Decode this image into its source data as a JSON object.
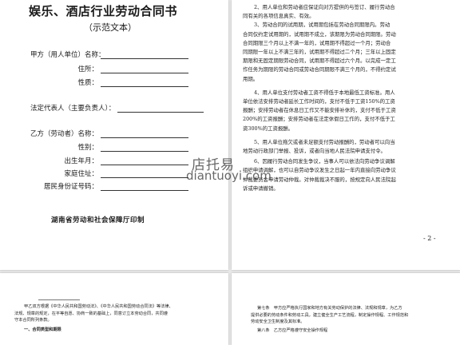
{
  "page1": {
    "title": "娱乐、酒店行业劳动合同书",
    "subtitle": "（示范文本）",
    "fields": [
      {
        "label": "甲方（用人单位）名称："
      },
      {
        "label": "住所："
      },
      {
        "label": "性质："
      },
      {
        "label": "法定代表人（主要负责人）："
      },
      {
        "label": "乙方（劳动者）名称："
      },
      {
        "label": "性别："
      },
      {
        "label": "出生年月："
      },
      {
        "label": "家庭住址："
      },
      {
        "label": "居民身份证号码："
      }
    ],
    "issuer": "湖南省劳动和社会保障厅印制"
  },
  "page2": {
    "lines": [
      "2、用人单位和劳动者应保证向对方提供的与签订、履行劳动合",
      "同有关的各项信息真实、有效。",
      "3、劳动合同的试用期，试用期包括在劳动合同期限内。劳动",
      "合同仅约定试用期的，试用期不成立，该期限为劳动合同期限。劳动",
      "合同期限三个月以上不满一年的，试用期不得超过一个月；劳动合",
      "同期限一年以上不满三年的，试用期不得超过二个月；三年以上固定",
      "期限和无固定期限劳动合同，试用期不得超过六个月。以完成一定工",
      "作任务为期限的劳动合同或劳动合同期限不满三个月的，不得约定试",
      "用期。",
      "4、用人单位支付劳动者工资不得低于本地最低工资标准。用人",
      "单位依法安排劳动者延长工作时间的，支付不低于工资150%的工资",
      "报酬；安排劳动者在休息日工作又不能安排补休的，支付不低于工资",
      "200%的工资报酬；安排劳动者在法定休假日工作的，支付不低于工",
      "资300%的工资报酬。",
      "5、用人单位拖欠或者未足额支付劳动报酬的，劳动者可以向当",
      "地劳动行政部门举报、投诉，或者向当地人民法院申请支付令。",
      "6、因履行劳动合同发生争议，当事人可以依法向劳动争议调解",
      "组织申请调解，也可以自劳动争议发生之日起一年内直接向劳动争议",
      "仲裁委员会申请劳动仲裁。对仲裁裁决不服的，按规定向人民法院起",
      "诉或申请撤销。"
    ],
    "page_number": "- 2 -"
  },
  "page3": {
    "lines": [
      "甲乙双方根据《中华人民共和国劳动法》、《中华人民共和国劳动合同法》等法律、",
      "法规、规章的规定，在平等自愿、协商一致的基础上，同意订立本劳动合同，共同遵",
      "守本合同所列条款。",
      "一、合同类型和期限"
    ]
  },
  "page4": {
    "lines": [
      "第七条　甲方应严格执行国家和地方有关劳动保护的法律、法规和规章，为乙方",
      "提供必要的劳动条件和劳动工具，建立健全生产工艺流程，制定操作规程、工作规范和",
      "劳动安全卫生制度及其标准。",
      "第八条　乙方应严格遵守安全操作规程"
    ]
  },
  "watermark": {
    "name": "店托易",
    "domain": "diantuoyi.com"
  }
}
